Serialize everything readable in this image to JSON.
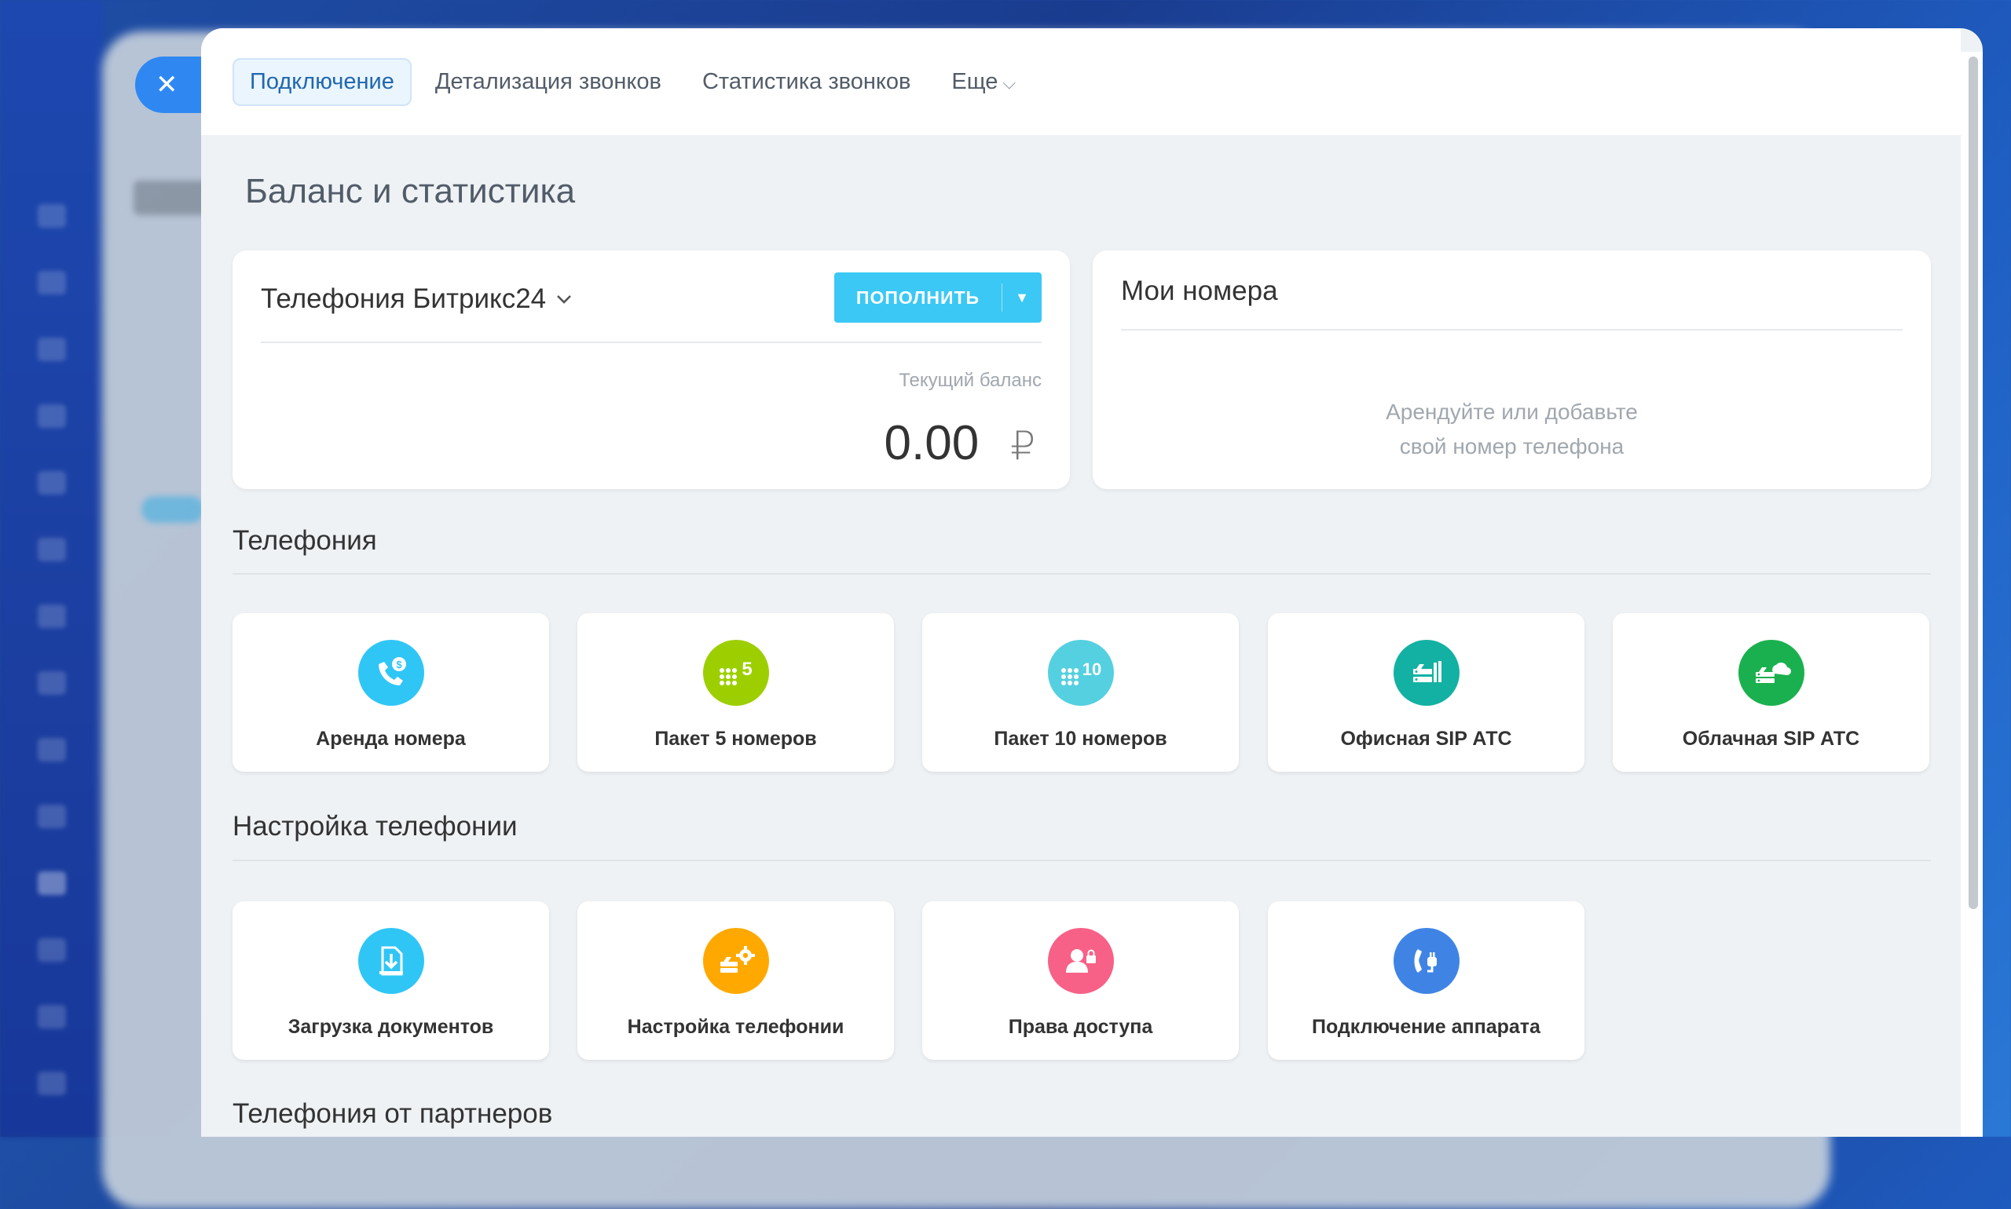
{
  "tabs": [
    {
      "label": "Подключение",
      "active": true
    },
    {
      "label": "Детализация звонков"
    },
    {
      "label": "Статистика звонков"
    },
    {
      "label": "Еще",
      "has_dropdown": true
    }
  ],
  "page_title": "Баланс и статистика",
  "balance": {
    "provider": "Телефония Битрикс24",
    "topup_label": "ПОПОЛНИТЬ",
    "label": "Текущий баланс",
    "value": "0.00",
    "currency": "₽"
  },
  "my_numbers": {
    "title": "Мои номера",
    "empty_line1": "Арендуйте или добавьте",
    "empty_line2": "свой номер телефона"
  },
  "sections": {
    "telephony": {
      "title": "Телефония",
      "tiles": [
        {
          "label": "Аренда номера",
          "icon": "phone-dollar-icon",
          "color": "#2fc6f6"
        },
        {
          "label": "Пакет 5 номеров",
          "icon": "keypad-5-icon",
          "color": "#9dcf00"
        },
        {
          "label": "Пакет 10 номеров",
          "icon": "keypad-10-icon",
          "color": "#55d0e0"
        },
        {
          "label": "Офисная SIP АТС",
          "icon": "office-pbx-icon",
          "color": "#13b1a3"
        },
        {
          "label": "Облачная SIP АТС",
          "icon": "cloud-pbx-icon",
          "color": "#1bb04f"
        }
      ]
    },
    "settings": {
      "title": "Настройка телефонии",
      "tiles": [
        {
          "label": "Загрузка документов",
          "icon": "document-download-icon",
          "color": "#2fc6f6"
        },
        {
          "label": "Настройка телефонии",
          "icon": "settings-gear-icon",
          "color": "#ffa900"
        },
        {
          "label": "Права доступа",
          "icon": "user-lock-icon",
          "color": "#f76187"
        },
        {
          "label": "Подключение аппарата",
          "icon": "phone-plug-icon",
          "color": "#3f84e5"
        }
      ]
    },
    "partners": {
      "title": "Телефония от партнеров"
    }
  }
}
